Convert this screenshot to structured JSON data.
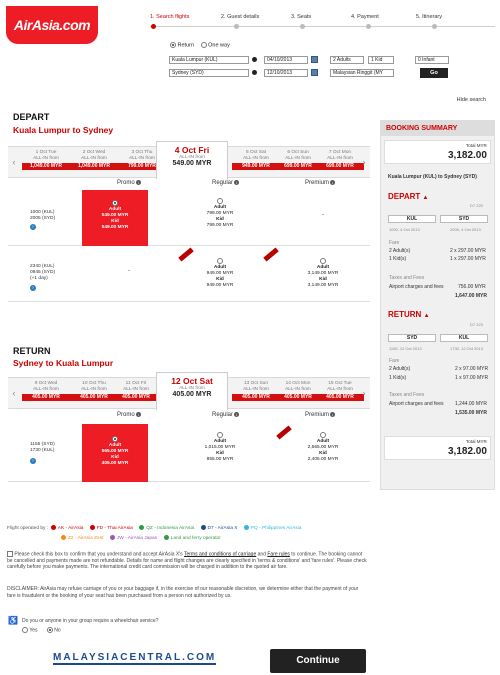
{
  "header": {
    "logo": "AirAsia.com",
    "steps": [
      "1. Search flights",
      "2. Guest details",
      "3. Seats",
      "4. Payment",
      "5. Itinerary"
    ],
    "trip_return": "Return",
    "trip_oneway": "One way",
    "from": "Kuala Lumpur (KUL)",
    "to": "Sydney (SYD)",
    "depart_date": "04/10/2013",
    "return_date": "12/10/2013",
    "adults": "2 Adults",
    "kids": "1 Kid",
    "infants": "0 Infant",
    "currency": "Malaysian Ringgit (MY",
    "go": "Go",
    "hide_search": "Hide search"
  },
  "depart": {
    "title": "DEPART",
    "route": "Kuala Lumpur  to  Sydney",
    "dates": [
      {
        "d": "1 Oct Tue",
        "p": "1,049.00 MYR"
      },
      {
        "d": "2 Oct Wed",
        "p": "1,049.00 MYR"
      },
      {
        "d": "3 Oct Thu",
        "p": "799.00 MYR"
      }
    ],
    "selected": {
      "d": "4 Oct Fri",
      "s": "ALL-IN from",
      "p": "549.00 MYR"
    },
    "dates_after": [
      {
        "d": "5 Oct Sat",
        "p": "949.00 MYR"
      },
      {
        "d": "6 Oct Sun",
        "p": "699.00 MYR"
      },
      {
        "d": "7 Oct Mon",
        "p": "699.00 MYR"
      }
    ],
    "allin": "ALL-IN from",
    "cols": [
      "Promo",
      "Regular",
      "Premium"
    ],
    "flights": [
      {
        "t1": "1000  (KUL)",
        "t2": "2005  (SYD)",
        "t3": "",
        "promo": [
          "Adult",
          "549.00 MYR",
          "Kid",
          "549.00 MYR"
        ],
        "regular": [
          "Adult",
          "799.00 MYR",
          "Kid",
          "799.00 MYR"
        ],
        "premium": "-"
      },
      {
        "t1": "2340  (KUL)",
        "t2": "0945  (SYD)",
        "t3": "(+1 day)",
        "promo": "-",
        "regular": [
          "Adult",
          "949.00 MYR",
          "Kid",
          "949.00 MYR"
        ],
        "premium": [
          "Adult",
          "3,149.00 MYR",
          "Kid",
          "3,149.00 MYR"
        ]
      }
    ]
  },
  "ret": {
    "title": "RETURN",
    "route": "Sydney  to  Kuala Lumpur",
    "dates": [
      {
        "d": "9 Oct Wed",
        "p": "405.00 MYR"
      },
      {
        "d": "10 Oct Thu",
        "p": "405.00 MYR"
      },
      {
        "d": "11 Oct Fri",
        "p": "405.00 MYR"
      }
    ],
    "selected": {
      "d": "12 Oct Sat",
      "s": "ALL-IN from",
      "p": "405.00 MYR"
    },
    "dates_after": [
      {
        "d": "13 Oct Sun",
        "p": "405.00 MYR"
      },
      {
        "d": "14 Oct Mon",
        "p": "405.00 MYR"
      },
      {
        "d": "15 Oct Tue",
        "p": "405.00 MYR"
      }
    ],
    "allin": "ALL-IN from",
    "cols": [
      "Promo",
      "Regular",
      "Premium"
    ],
    "flights": [
      {
        "t1": "1155  (SYD)",
        "t2": "1730  (KUL)",
        "promo": [
          "Adult",
          "565.00 MYR",
          "Kid",
          "405.00 MYR"
        ],
        "regular": [
          "Adult",
          "1,015.00 MYR",
          "Kid",
          "855.00 MYR"
        ],
        "premium": [
          "Adult",
          "2,565.00 MYR",
          "Kid",
          "2,405.00 MYR"
        ]
      }
    ]
  },
  "summary": {
    "title": "BOOKING SUMMARY",
    "total_label": "Total MYR",
    "total": "3,182.00",
    "route": "Kuala Lumpur (KUL) to Sydney (SYD)",
    "depart": "DEPART",
    "d_flight": "D7 220",
    "d_from": "KUL",
    "d_to": "SYD",
    "d_from_t": "1000, 4 Oct 2013",
    "d_to_t": "2005, 4 Oct 2013",
    "fare": "Fare",
    "d_adult": "2 Adult(s)",
    "d_adult_p": "2 x 297.00 MYR",
    "d_kid": "1 Kid(s)",
    "d_kid_p": "1 x 297.00 MYR",
    "taxes": "Taxes and Fees",
    "d_tax": "Airport charges and fees",
    "d_tax_p": "756.00 MYR",
    "d_sub": "1,647.00 MYR",
    "return": "RETURN",
    "r_flight": "D7 223",
    "r_from": "SYD",
    "r_to": "KUL",
    "r_from_t": "1155, 12 Oct 2013",
    "r_to_t": "1730, 12 Oct 2013",
    "r_adult": "2 Adult(s)",
    "r_adult_p": "2 x 97.00 MYR",
    "r_kid": "1 Kid(s)",
    "r_kid_p": "1 x 97.00 MYR",
    "r_tax": "Airport charges and fees",
    "r_tax_p": "1,244.00 MYR",
    "r_sub": "1,535.00 MYR",
    "total2": "3,182.00"
  },
  "footer": {
    "operated": "Flight operated by :",
    "operators": [
      {
        "n": "AK - AirAsia",
        "c": "#cc0000"
      },
      {
        "n": "FD - Thai AirAsia",
        "c": "#cc0000"
      },
      {
        "n": "QZ - Indonesia AirAsia",
        "c": "#2e9b48"
      },
      {
        "n": "D7 - AirAsia X",
        "c": "#1c4b8c"
      },
      {
        "n": "PQ - Philippines AirAsia",
        "c": "#33b5e5"
      },
      {
        "n": "Z2 - AirAsia Zest",
        "c": "#f08c1a"
      },
      {
        "n": "JW - AirAsia Japan",
        "c": "#9b59b6"
      },
      {
        "n": "Land and ferry operator",
        "c": "#2e9b48"
      }
    ],
    "terms1": "Please check this box to confirm that you understand and accept AirAsia X's",
    "terms_link1": "Terms and conditions of carriage",
    "and": "and",
    "terms_link2": "Fare rules",
    "terms2": "to continue. The booking cannot be cancelled and payments made are not refundable. Details for name and flight changes are clearly specified in 'terms & conditions' and 'fare rules'. Please check carefully before you make payments. The international credit card commission will be charged in addition to the quoted air fare.",
    "disclaimer": "DISCLAIMER: AirAsia may refuse carriage of you or your baggage if, in the exercise of our reasonable discretion, we determine either that the payment of your fare is fraudulent or the booking of your seat has been purchased from a person not authorized by us.",
    "wheelchair": "Do you or anyone in your group require a wheelchair service?",
    "yes": "Yes",
    "no": "No",
    "brand": "MALAYSIACENTRAL.COM",
    "continue": "Continue"
  }
}
